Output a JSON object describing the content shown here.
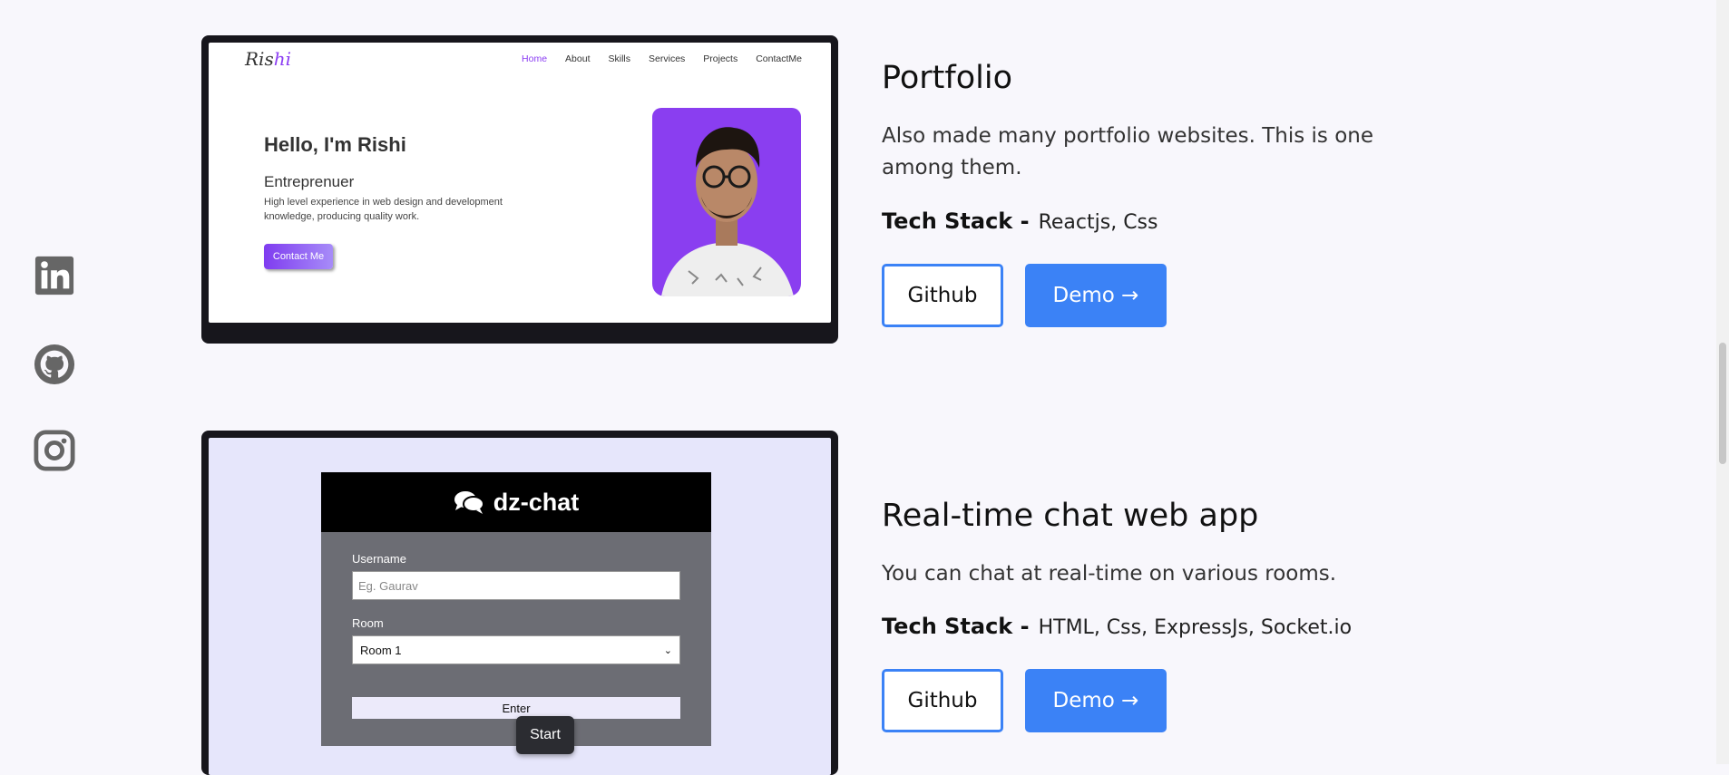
{
  "social": [
    {
      "name": "linkedin-icon"
    },
    {
      "name": "github-icon"
    },
    {
      "name": "instagram-icon"
    }
  ],
  "projects": [
    {
      "title": "Portfolio",
      "description": "Also made many portfolio websites. This is one among them.",
      "tech_label": "Tech Stack -",
      "tech_value": "Reactjs, Css",
      "github_label": "Github",
      "demo_label": "Demo →",
      "preview": {
        "logo_a": "Ris",
        "logo_b": "hi",
        "nav": [
          "Home",
          "About",
          "Skills",
          "Services",
          "Projects",
          "ContactMe"
        ],
        "hello": "Hello, I'm Rishi",
        "role": "Entreprenuer",
        "desc": "High level experience in web design and development knowledge, producing quality work.",
        "button": "Contact Me"
      }
    },
    {
      "title": "Real-time chat web app",
      "description": "You can chat at real-time on various rooms.",
      "tech_label": "Tech Stack -",
      "tech_value": "HTML, Css, ExpressJs, Socket.io",
      "github_label": "Github",
      "demo_label": "Demo →",
      "preview": {
        "app_title": "dz-chat",
        "username_label": "Username",
        "username_placeholder": "Eg. Gaurav",
        "room_label": "Room",
        "room_value": "Room 1",
        "enter_label": "Enter"
      }
    }
  ],
  "tooltip": "Start",
  "colors": {
    "accent": "#3b82f6",
    "portfolio_purple": "#8b3df3",
    "page_bg": "#f8f7fc"
  }
}
